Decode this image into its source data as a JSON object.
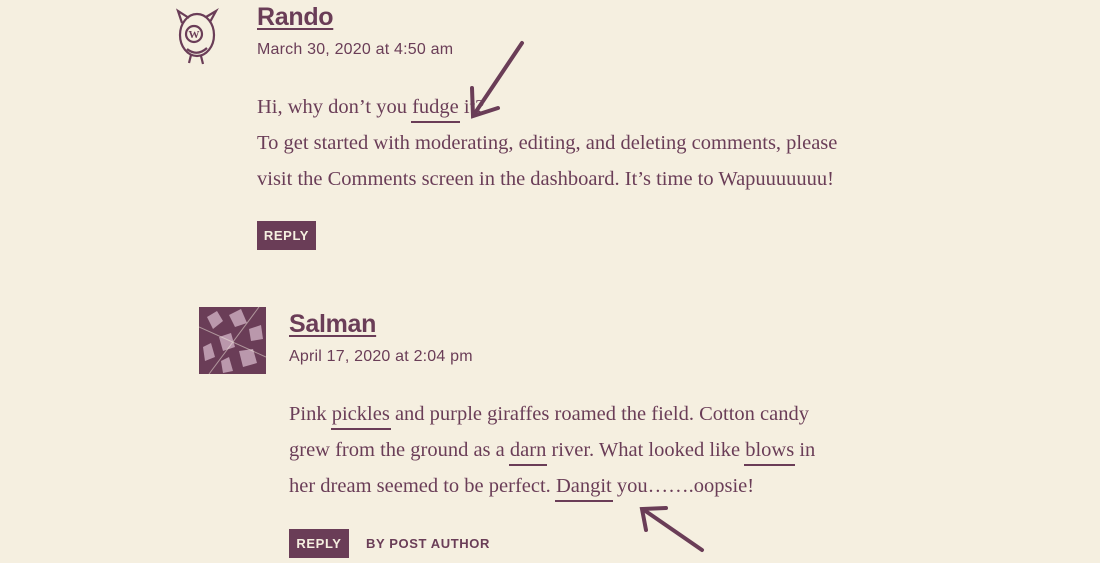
{
  "comment1": {
    "author": "Rando",
    "date": "March 30, 2020 at 4:50 am",
    "avatar": "wapuu-avatar-icon",
    "line1_a": "Hi, why don’t you ",
    "line1_u": "fudge",
    "line1_b": " it?",
    "line2": "To get started with moderating, editing, and deleting comments, please",
    "line3": "visit the Comments screen in the dashboard. It’s time to Wapuuuuuuu!",
    "reply_label": "REPLY"
  },
  "comment2": {
    "author": "Salman",
    "date": "April 17, 2020 at 2:04 pm",
    "avatar": "photo-avatar",
    "l1_a": "Pink ",
    "l1_u": "pickles",
    "l1_b": " and purple giraffes roamed the field. Cotton candy",
    "l2_a": "grew from the ground as a ",
    "l2_u1": "darn",
    "l2_b": " river. What looked like ",
    "l2_u2": "blows",
    "l2_c": " in",
    "l3_a": "her dream seemed to be perfect. ",
    "l3_u": "Dangit",
    "l3_b": " you…….oopsie!",
    "reply_label": "REPLY",
    "badge": "BY POST AUTHOR"
  },
  "colors": {
    "accent": "#6a3d57",
    "background": "#f5efe0"
  },
  "annotations": [
    "arrow-icon",
    "arrow-icon"
  ]
}
